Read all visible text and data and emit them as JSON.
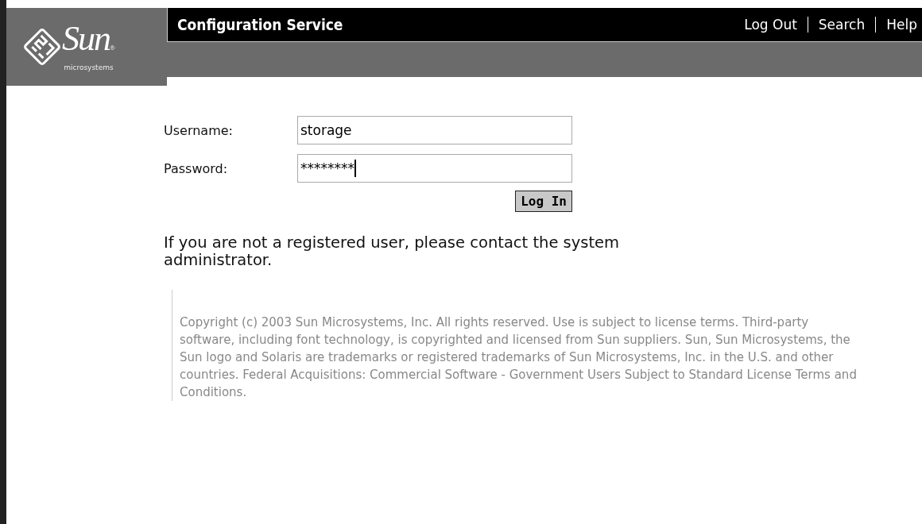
{
  "logo": {
    "name": "Sun",
    "tagline": "microsystems",
    "mark": "®"
  },
  "header": {
    "title": "Configuration Service",
    "links": [
      "Log Out",
      "Search",
      "Help"
    ]
  },
  "form": {
    "fields": [
      {
        "label": "Username:",
        "value": "storage",
        "focused": false
      },
      {
        "label": "Password:",
        "value": "********",
        "focused": true
      }
    ],
    "button": "Log In"
  },
  "notice": "If you are not a registered user, please contact the system administrator.",
  "copyright": "Copyright (c) 2003 Sun Microsystems, Inc. All rights reserved. Use is subject to license terms. Third-party software, including font technology, is copyrighted and licensed from Sun suppliers. Sun, Sun Microsystems, the Sun logo and Solaris are trademarks or registered trademarks of Sun Microsystems, Inc. in the U.S. and other countries. Federal Acquisitions: Commercial Software - Government Users Subject to Standard License Terms and Conditions."
}
